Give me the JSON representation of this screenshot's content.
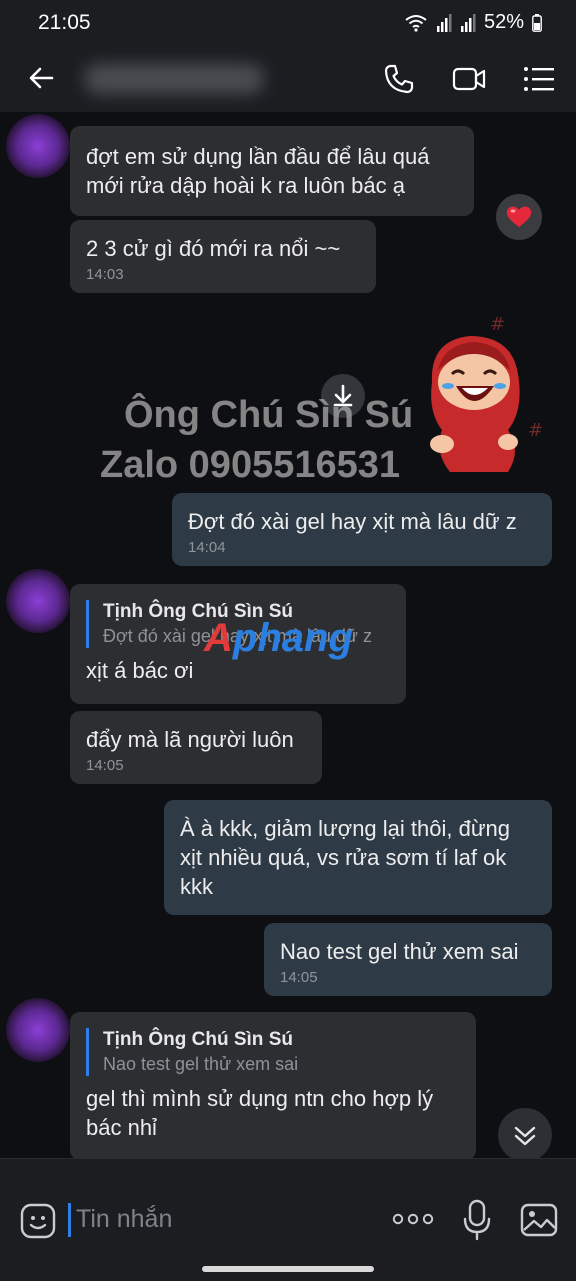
{
  "status_bar": {
    "time": "21:05",
    "battery": "52%"
  },
  "header": {
    "contact_name": ""
  },
  "messages": [
    {
      "lines": [
        "đợt em sử dụng lần đầu để lâu quá",
        "mới rửa dập hoài k ra luôn bác ạ"
      ]
    },
    {
      "text": "2 3 cử gì đó mới ra nổi ~~",
      "time": "14:03",
      "reaction": "heart"
    },
    {
      "text": "Đợt đó xài gel hay xịt mà lâu dữ z",
      "time": "14:04"
    },
    {
      "quote_name": "Tịnh Ông Chú Sìn Sú",
      "quote_text": "Đợt đó xài gel hay xịt mà lâu dữ z",
      "text": "xịt á bác ơi"
    },
    {
      "text": "đẩy mà lã người luôn",
      "time": "14:05"
    },
    {
      "lines": [
        "À à kkk, giảm lượng lại thôi, đừng",
        "xịt nhiều quá, vs rửa sơm tí laf ok",
        "kkk"
      ]
    },
    {
      "text": "Nao test gel thử xem sai",
      "time": "14:05"
    },
    {
      "quote_name": "Tịnh Ông Chú Sìn Sú",
      "quote_text": "Nao test gel thử xem sai",
      "lines": [
        "gel thì mình sử dụng ntn cho hợp lý",
        "bác nhỉ"
      ]
    }
  ],
  "watermark": {
    "line1": "Ông Chú Sìn Sú",
    "line2": "Zalo 0905516531"
  },
  "logo": {
    "part1": "A",
    "part2": "phang",
    "color1": "#e23b3b",
    "color2": "#2b7fe0"
  },
  "input": {
    "placeholder": "Tin nhắn"
  },
  "colors": {
    "accent": "#2f7de8",
    "incoming": "#2c2e31",
    "outgoing": "#2e3b47",
    "heart": "#e5283a"
  }
}
